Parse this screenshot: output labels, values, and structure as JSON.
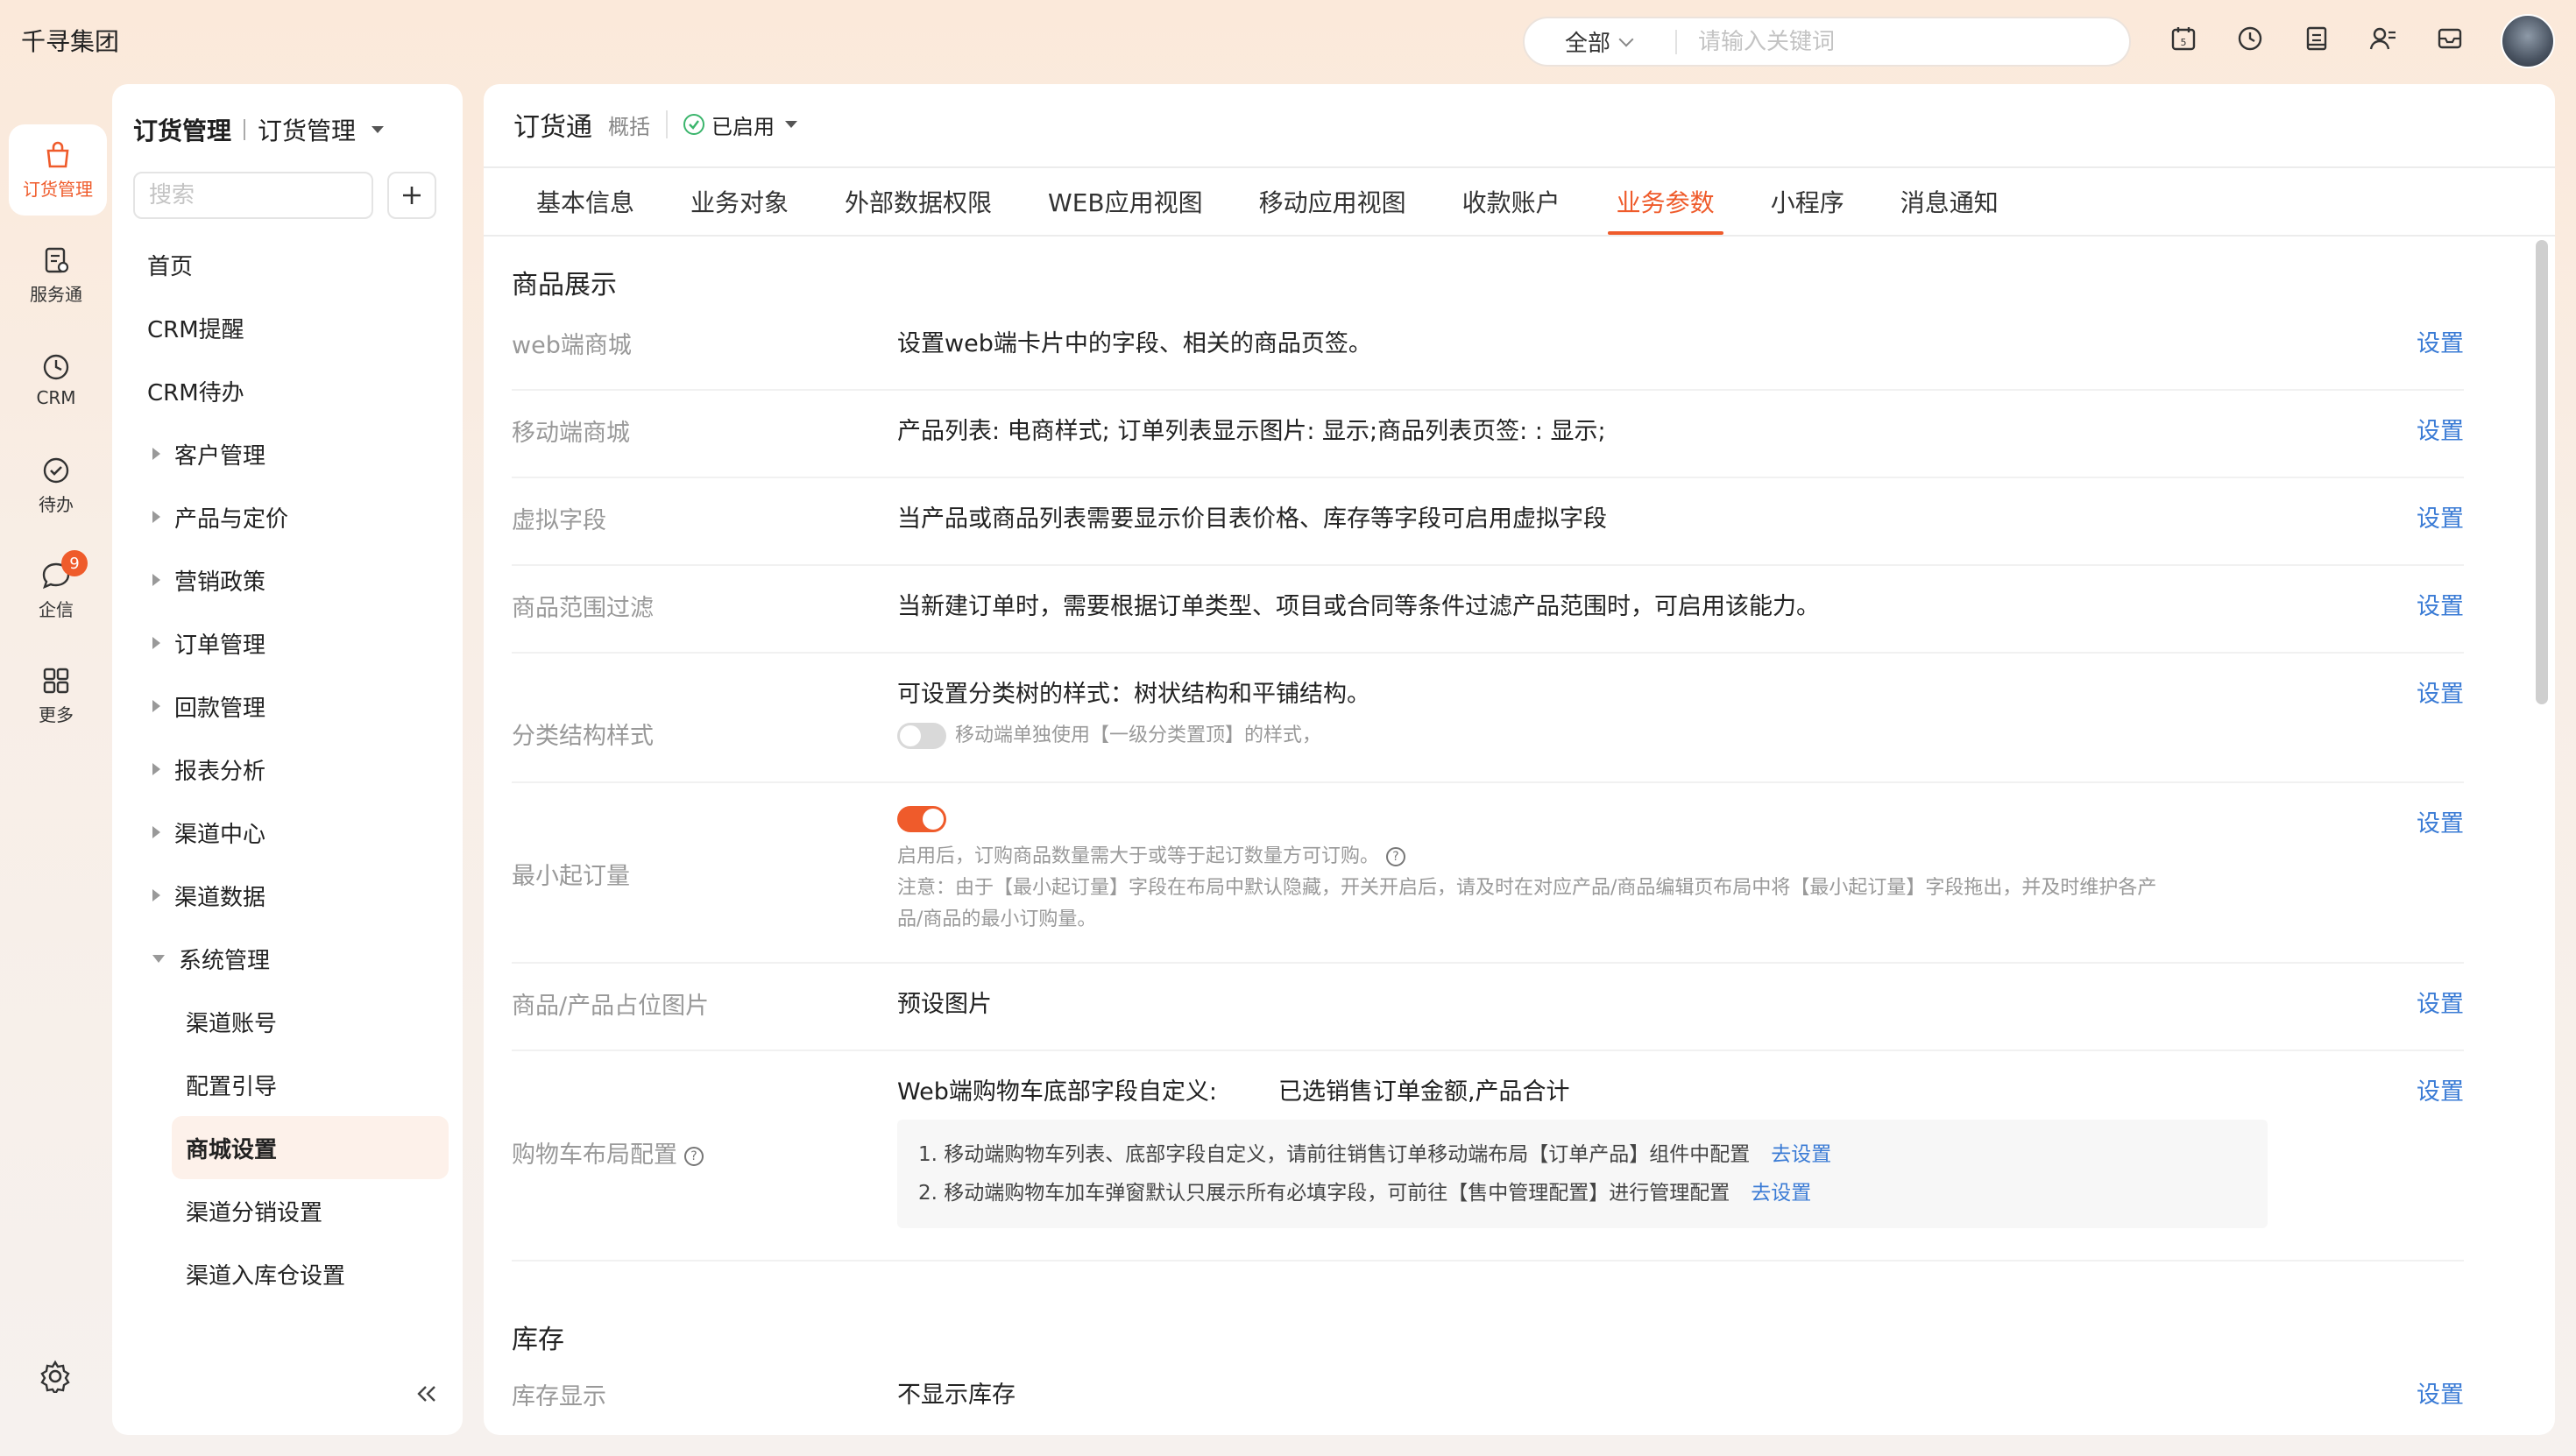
{
  "app": {
    "brand": "千寻集团"
  },
  "topbar": {
    "search_scope": "全部",
    "search_placeholder": "请输入关键词",
    "icons": [
      "calendar-icon",
      "clock-icon",
      "document-icon",
      "user-settings-icon",
      "inbox-icon"
    ]
  },
  "rail": {
    "items": [
      {
        "label": "订货管理",
        "icon": "bag-icon",
        "active": true
      },
      {
        "label": "服务通",
        "icon": "service-icon"
      },
      {
        "label": "CRM",
        "icon": "crm-icon"
      },
      {
        "label": "待办",
        "icon": "check-circle-icon"
      },
      {
        "label": "企信",
        "icon": "chat-icon",
        "badge": "9"
      },
      {
        "label": "更多",
        "icon": "grid-icon"
      }
    ]
  },
  "sidebar": {
    "title": "订货管理",
    "scope": "订货管理",
    "search_placeholder": "搜索",
    "items": [
      {
        "label": "首页"
      },
      {
        "label": "CRM提醒"
      },
      {
        "label": "CRM待办"
      },
      {
        "label": "客户管理"
      },
      {
        "label": "产品与定价"
      },
      {
        "label": "营销政策"
      },
      {
        "label": "订单管理"
      },
      {
        "label": "回款管理"
      },
      {
        "label": "报表分析"
      },
      {
        "label": "渠道中心"
      },
      {
        "label": "渠道数据"
      },
      {
        "label": "系统管理"
      }
    ],
    "sub_items": [
      {
        "label": "渠道账号"
      },
      {
        "label": "配置引导"
      },
      {
        "label": "商城设置"
      },
      {
        "label": "渠道分销设置"
      },
      {
        "label": "渠道入库仓设置"
      }
    ]
  },
  "main": {
    "title": "订货通",
    "subtitle": "概括",
    "status": "已启用",
    "tabs": [
      "基本信息",
      "业务对象",
      "外部数据权限",
      "WEB应用视图",
      "移动应用视图",
      "收款账户",
      "业务参数",
      "小程序",
      "消息通知"
    ],
    "active_tab": "业务参数",
    "section1_title": "商品展示",
    "action_label": "设置",
    "rows": {
      "web_mall": {
        "label": "web端商城",
        "value": "设置web端卡片中的字段、相关的商品页签。"
      },
      "mobile_mall": {
        "label": "移动端商城",
        "value": "产品列表: 电商样式; 订单列表显示图片: 显示;商品列表页签: : 显示;"
      },
      "virtual_field": {
        "label": "虚拟字段",
        "value": "当产品或商品列表需要显示价目表价格、库存等字段可启用虚拟字段"
      },
      "range_filter": {
        "label": "商品范围过滤",
        "value": "当新建订单时，需要根据订单类型、项目或合同等条件过滤产品范围时，可启用该能力。"
      },
      "category_style": {
        "label": "分类结构样式",
        "value": "可设置分类树的样式：树状结构和平铺结构。",
        "toggle_text": "移动端单独使用【一级分类置顶】的样式，",
        "toggle_on": false
      },
      "min_order": {
        "label": "最小起订量",
        "toggle_on": true,
        "hint1": "启用后，订购商品数量需大于或等于起订数量方可订购。",
        "hint2": "注意：由于【最小起订量】字段在布局中默认隐藏，开关开启后，请及时在对应产品/商品编辑页布局中将【最小起订量】字段拖出，并及时维护各产",
        "hint3": "品/商品的最小订购量。"
      },
      "placeholder_img": {
        "label": "商品/产品占位图片",
        "value": "预设图片"
      },
      "cart_layout": {
        "label": "购物车布局配置",
        "value_label": "Web端购物车底部字段自定义:",
        "value": "已选销售订单金额,产品合计",
        "note1": "1. 移动端购物车列表、底部字段自定义，请前往销售订单移动端布局【订单产品】组件中配置",
        "note2": "2. 移动端购物车加车弹窗默认只展示所有必填字段，可前往【售中管理配置】进行管理配置",
        "link": "去设置"
      }
    },
    "section2_title": "库存",
    "stock": {
      "label": "库存显示",
      "value": "不显示库存"
    }
  },
  "colors": {
    "accent": "#ef5b2b",
    "link": "#3a7bd5",
    "enabled": "#3bb56c"
  }
}
